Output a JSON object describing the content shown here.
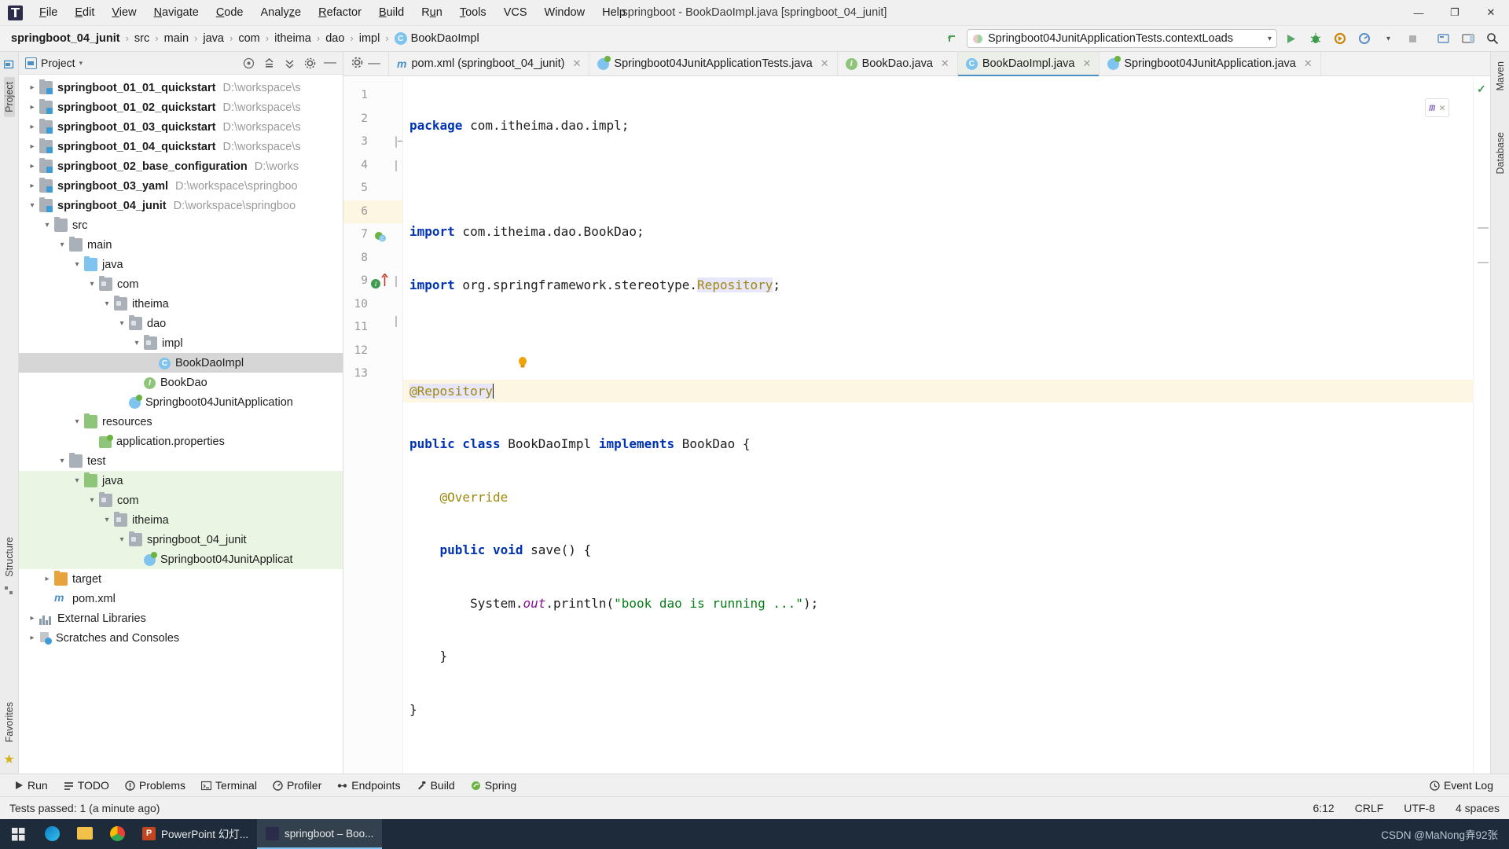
{
  "window": {
    "title": "springboot - BookDaoImpl.java [springboot_04_junit]",
    "minimize": "—",
    "maximize": "❐",
    "close": "✕"
  },
  "menu": {
    "items": [
      "File",
      "Edit",
      "View",
      "Navigate",
      "Code",
      "Analyze",
      "Refactor",
      "Build",
      "Run",
      "Tools",
      "VCS",
      "Window",
      "Help"
    ]
  },
  "breadcrumb": {
    "items": [
      "springboot_04_junit",
      "src",
      "main",
      "java",
      "com",
      "itheima",
      "dao",
      "impl"
    ],
    "file": "BookDaoImpl",
    "file_icon_letter": "C",
    "separator": "›"
  },
  "run_config": {
    "name": "Springboot04JunitApplicationTests.contextLoads",
    "dropdown_arrow": "▾",
    "buttons": {
      "run": "▶",
      "debug": "debug-icon",
      "run_with_coverage": "coverage-icon",
      "profiler": "profiler-icon",
      "more": "▾",
      "stop": "■",
      "build_project": "hammer-icon",
      "updates": "update-icon",
      "layout": "layout-icon",
      "search": "⌕"
    }
  },
  "project_panel": {
    "title": "Project",
    "title_dropdown": "▾",
    "actions": [
      "target-icon",
      "collapse-all-icon",
      "expand-icon",
      "settings-gear-icon",
      "hide-icon"
    ],
    "tree": [
      {
        "label": "springboot_01_01_quickstart",
        "path": "D:\\workspace\\s",
        "icon": "module-folder",
        "indent": 0,
        "arrow": "collapsed",
        "bold": true
      },
      {
        "label": "springboot_01_02_quickstart",
        "path": "D:\\workspace\\s",
        "icon": "module-folder",
        "indent": 0,
        "arrow": "collapsed",
        "bold": true
      },
      {
        "label": "springboot_01_03_quickstart",
        "path": "D:\\workspace\\s",
        "icon": "module-folder",
        "indent": 0,
        "arrow": "collapsed",
        "bold": true
      },
      {
        "label": "springboot_01_04_quickstart",
        "path": "D:\\workspace\\s",
        "icon": "module-folder",
        "indent": 0,
        "arrow": "collapsed",
        "bold": true
      },
      {
        "label": "springboot_02_base_configuration",
        "path": "D:\\works",
        "icon": "module-folder",
        "indent": 0,
        "arrow": "collapsed",
        "bold": true
      },
      {
        "label": "springboot_03_yaml",
        "path": "D:\\workspace\\springboo",
        "icon": "module-folder",
        "indent": 0,
        "arrow": "collapsed",
        "bold": true
      },
      {
        "label": "springboot_04_junit",
        "path": "D:\\workspace\\springboo",
        "icon": "module-folder",
        "indent": 0,
        "arrow": "expanded",
        "bold": true
      },
      {
        "label": "src",
        "path": "",
        "icon": "folder",
        "indent": 1,
        "arrow": "expanded",
        "bold": false
      },
      {
        "label": "main",
        "path": "",
        "icon": "folder",
        "indent": 2,
        "arrow": "expanded",
        "bold": false
      },
      {
        "label": "java",
        "path": "",
        "icon": "folder-blue",
        "indent": 3,
        "arrow": "expanded",
        "bold": false
      },
      {
        "label": "com",
        "path": "",
        "icon": "package",
        "indent": 4,
        "arrow": "expanded",
        "bold": false
      },
      {
        "label": "itheima",
        "path": "",
        "icon": "package",
        "indent": 5,
        "arrow": "expanded",
        "bold": false
      },
      {
        "label": "dao",
        "path": "",
        "icon": "package",
        "indent": 6,
        "arrow": "expanded",
        "bold": false
      },
      {
        "label": "impl",
        "path": "",
        "icon": "package",
        "indent": 7,
        "arrow": "expanded",
        "bold": false
      },
      {
        "label": "BookDaoImpl",
        "path": "",
        "icon": "class",
        "indent": 8,
        "arrow": "none",
        "bold": false,
        "selected": true
      },
      {
        "label": "BookDao",
        "path": "",
        "icon": "interface",
        "indent": 7,
        "arrow": "none",
        "bold": false
      },
      {
        "label": "Springboot04JunitApplication",
        "path": "",
        "icon": "spring-class",
        "indent": 6,
        "arrow": "none",
        "bold": false
      },
      {
        "label": "resources",
        "path": "",
        "icon": "folder-green",
        "indent": 3,
        "arrow": "expanded",
        "bold": false
      },
      {
        "label": "application.properties",
        "path": "",
        "icon": "properties",
        "indent": 4,
        "arrow": "none",
        "bold": false
      },
      {
        "label": "test",
        "path": "",
        "icon": "folder",
        "indent": 2,
        "arrow": "expanded",
        "bold": false
      },
      {
        "label": "java",
        "path": "",
        "icon": "folder-green",
        "indent": 3,
        "arrow": "expanded",
        "bold": false,
        "test": true
      },
      {
        "label": "com",
        "path": "",
        "icon": "package",
        "indent": 4,
        "arrow": "expanded",
        "bold": false,
        "test": true
      },
      {
        "label": "itheima",
        "path": "",
        "icon": "package",
        "indent": 5,
        "arrow": "expanded",
        "bold": false,
        "test": true
      },
      {
        "label": "springboot_04_junit",
        "path": "",
        "icon": "package",
        "indent": 6,
        "arrow": "expanded",
        "bold": false,
        "test": true
      },
      {
        "label": "Springboot04JunitApplicat",
        "path": "",
        "icon": "spring-class",
        "indent": 7,
        "arrow": "none",
        "bold": false,
        "test": true
      },
      {
        "label": "target",
        "path": "",
        "icon": "folder-orange",
        "indent": 1,
        "arrow": "collapsed",
        "bold": false
      },
      {
        "label": "pom.xml",
        "path": "",
        "icon": "maven",
        "indent": 1,
        "arrow": "none",
        "bold": false
      },
      {
        "label": "External Libraries",
        "path": "",
        "icon": "library",
        "indent": 0,
        "arrow": "collapsed",
        "bold": false
      },
      {
        "label": "Scratches and Consoles",
        "path": "",
        "icon": "scratch",
        "indent": 0,
        "arrow": "collapsed",
        "bold": false
      }
    ]
  },
  "left_stripe": {
    "labels": [
      "Project",
      "Structure",
      "Favorites"
    ]
  },
  "right_stripe": {
    "labels": [
      "Maven",
      "Database"
    ]
  },
  "editor_tabs": [
    {
      "label": "pom.xml (springboot_04_junit)",
      "icon": "maven-xml",
      "active": false,
      "close": "✕"
    },
    {
      "label": "Springboot04JunitApplicationTests.java",
      "icon": "spring-class",
      "active": false,
      "close": "✕"
    },
    {
      "label": "BookDao.java",
      "icon": "interface",
      "active": false,
      "close": "✕"
    },
    {
      "label": "BookDaoImpl.java",
      "icon": "class",
      "active": true,
      "close": "✕"
    },
    {
      "label": "Springboot04JunitApplication.java",
      "icon": "spring-class",
      "active": false,
      "close": "✕"
    }
  ],
  "code": {
    "line_numbers": [
      "1",
      "2",
      "3",
      "4",
      "5",
      "6",
      "7",
      "8",
      "9",
      "10",
      "11",
      "12",
      "13"
    ],
    "current_line": 6,
    "caret_position": "6:12",
    "lines": [
      "package com.itheima.dao.impl;",
      "",
      "import com.itheima.dao.BookDao;",
      "import org.springframework.stereotype.Repository;",
      "",
      "@Repository",
      "public class BookDaoImpl implements BookDao {",
      "    @Override",
      "    public void save() {",
      "        System.out.println(\"book dao is running ...\");",
      "    }",
      "}",
      ""
    ],
    "string_literal": "\"book dao is running ...\""
  },
  "inspection_widget": {
    "label": "m",
    "close": "✕"
  },
  "bottom_bar": {
    "items": [
      {
        "label": "Run",
        "icon": "play-icon"
      },
      {
        "label": "TODO",
        "icon": "todo-icon"
      },
      {
        "label": "Problems",
        "icon": "problems-icon"
      },
      {
        "label": "Terminal",
        "icon": "terminal-icon"
      },
      {
        "label": "Profiler",
        "icon": "profiler-icon"
      },
      {
        "label": "Endpoints",
        "icon": "endpoints-icon"
      },
      {
        "label": "Build",
        "icon": "build-icon"
      },
      {
        "label": "Spring",
        "icon": "spring-icon"
      }
    ],
    "event_log": "Event Log"
  },
  "status_bar": {
    "message": "Tests passed: 1 (a minute ago)",
    "caret": "6:12",
    "line_separator": "CRLF",
    "encoding": "UTF-8",
    "indent": "4 spaces"
  },
  "taskbar": {
    "start": "⊞",
    "apps": [
      {
        "label": "",
        "icon": "edge-icon"
      },
      {
        "label": "",
        "icon": "explorer-icon"
      },
      {
        "label": "",
        "icon": "chrome-icon"
      },
      {
        "label": "PowerPoint 幻灯...",
        "icon": "powerpoint-icon"
      },
      {
        "label": "springboot – Boo...",
        "icon": "intellij-icon",
        "active": true
      }
    ],
    "watermark": "CSDN @MaNong弆92张"
  },
  "colors": {
    "accent": "#4a90c4",
    "keyword": "#0033b3",
    "string": "#067d17",
    "annotation": "#9e880d",
    "field": "#871094",
    "current_line": "#fdf6e3",
    "test_source": "#eaf5e4",
    "selection": "#d6d6d6",
    "spring_green": "#6db33f"
  }
}
